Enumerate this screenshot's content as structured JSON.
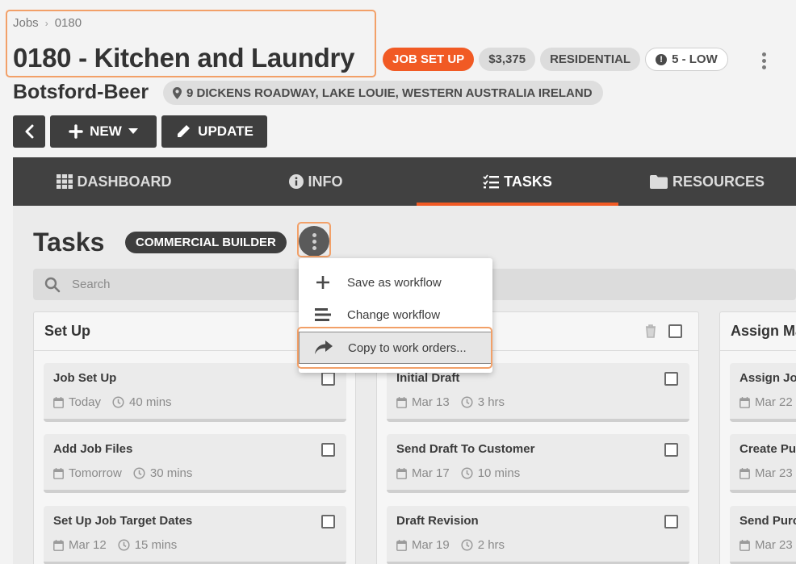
{
  "breadcrumb": {
    "root": "Jobs",
    "separator": "›",
    "current": "0180"
  },
  "job": {
    "title": "0180 - Kitchen and Laundry",
    "status": "JOB SET UP",
    "amount": "$3,375",
    "type": "RESIDENTIAL",
    "priority": "5 - LOW",
    "customer": "Botsford-Beer",
    "address": "9 DICKENS ROADWAY, LAKE LOUIE, WESTERN AUSTRALIA IRELAND"
  },
  "actions": {
    "new_label": "NEW",
    "update_label": "UPDATE"
  },
  "tabs": [
    {
      "label": "DASHBOARD",
      "icon": "grid-icon"
    },
    {
      "label": "INFO",
      "icon": "info-icon"
    },
    {
      "label": "TASKS",
      "icon": "checklist-icon",
      "active": true
    },
    {
      "label": "RESOURCES",
      "icon": "folder-icon"
    }
  ],
  "tasks": {
    "title": "Tasks",
    "workflow": "COMMERCIAL BUILDER",
    "search_placeholder": "Search"
  },
  "menu": {
    "items": [
      {
        "label": "Save as workflow",
        "icon": "plus-icon"
      },
      {
        "label": "Change workflow",
        "icon": "lines-icon"
      },
      {
        "label": "Copy to work orders...",
        "icon": "share-arrow-icon",
        "hovered": true
      }
    ]
  },
  "columns": [
    {
      "name": "Set Up",
      "cards": [
        {
          "title": "Job Set Up",
          "date": "Today",
          "duration": "40 mins"
        },
        {
          "title": "Add Job Files",
          "date": "Tomorrow",
          "duration": "30 mins"
        },
        {
          "title": "Set Up Job Target Dates",
          "date": "Mar 12",
          "duration": "15 mins"
        }
      ]
    },
    {
      "name": "",
      "cards": [
        {
          "title": "Initial Draft",
          "date": "Mar 13",
          "duration": "3 hrs"
        },
        {
          "title": "Send Draft To Customer",
          "date": "Mar 17",
          "duration": "10 mins"
        },
        {
          "title": "Draft Revision",
          "date": "Mar 19",
          "duration": "2 hrs"
        }
      ]
    },
    {
      "name": "Assign Ma",
      "cards": [
        {
          "title": "Assign Jo",
          "date": "Mar 22"
        },
        {
          "title": "Create Pu",
          "date": "Mar 23"
        },
        {
          "title": "Send Purc",
          "date": "Mar 23"
        }
      ]
    }
  ],
  "colors": {
    "accent": "#f15a24",
    "dark": "#414141",
    "highlight": "#f2a068"
  }
}
